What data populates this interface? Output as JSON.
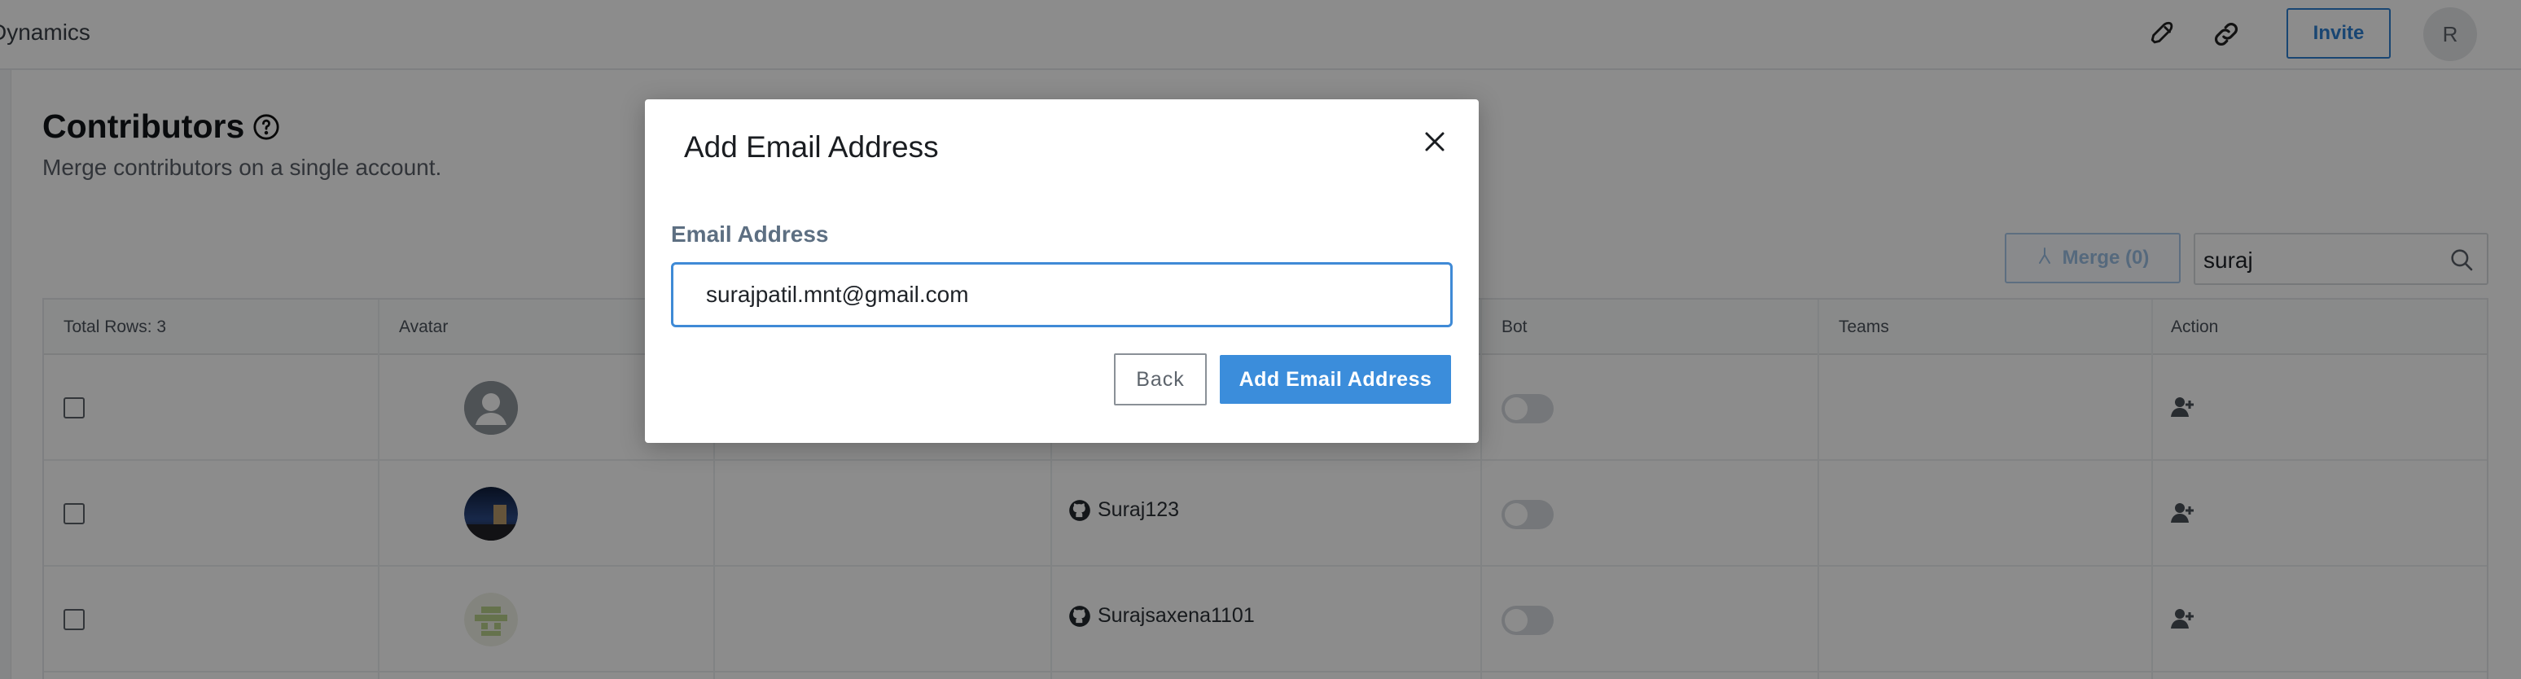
{
  "colors": {
    "accent": "#3b8ddb",
    "overlay": "rgba(0,0,0,0.45)",
    "label": "#5d6f82"
  },
  "topbar": {
    "project_name": "Dynamics",
    "icons": [
      "rocket-icon",
      "link-icon"
    ],
    "invite_label": "Invite",
    "user_initial": "R"
  },
  "page": {
    "title": "Contributors",
    "subtitle": "Merge contributors on a single account."
  },
  "toolbar": {
    "merge_label": "Merge (0)",
    "search_value": "suraj"
  },
  "table": {
    "total_rows_label": "Total Rows: 3",
    "columns": [
      "Avatar",
      "Bot",
      "Teams",
      "Action"
    ],
    "rows": [
      {
        "avatar": "default-user-avatar",
        "github_username": "",
        "bot": false
      },
      {
        "avatar": "photo-avatar",
        "github_username": "Suraj123",
        "bot": false
      },
      {
        "avatar": "identicon-avatar",
        "github_username": "Surajsaxena1101",
        "bot": false
      }
    ]
  },
  "modal": {
    "title": "Add Email Address",
    "field_label": "Email Address",
    "email_value": "surajpatil.mnt@gmail.com",
    "back_label": "Back",
    "submit_label": "Add Email Address"
  }
}
